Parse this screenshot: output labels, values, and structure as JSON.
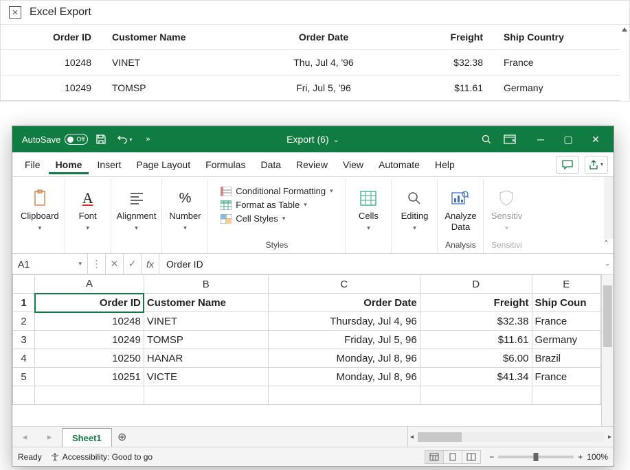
{
  "top": {
    "title": "Excel Export",
    "headers": {
      "id": "Order ID",
      "name": "Customer Name",
      "date": "Order Date",
      "freight": "Freight",
      "country": "Ship Country"
    },
    "rows": [
      {
        "id": "10248",
        "name": "VINET",
        "date": "Thu, Jul 4, '96",
        "freight": "$32.38",
        "country": "France"
      },
      {
        "id": "10249",
        "name": "TOMSP",
        "date": "Fri, Jul 5, '96",
        "freight": "$11.61",
        "country": "Germany"
      }
    ]
  },
  "excel": {
    "titlebar": {
      "autosave_label": "AutoSave",
      "autosave_state": "Off",
      "doc_title": "Export (6)"
    },
    "menu": [
      "File",
      "Home",
      "Insert",
      "Page Layout",
      "Formulas",
      "Data",
      "Review",
      "View",
      "Automate",
      "Help"
    ],
    "menu_active": "Home",
    "ribbon": {
      "clipboard": "Clipboard",
      "font": "Font",
      "alignment": "Alignment",
      "number": "Number",
      "styles": "Styles",
      "styles_items": {
        "cond": "Conditional Formatting",
        "table": "Format as Table",
        "cells": "Cell Styles"
      },
      "cells_grp": "Cells",
      "editing": "Editing",
      "analysis": "Analysis",
      "analyze": "Analyze\nData",
      "sensitivity_grp": "Sensitivi",
      "sensitivity": "Sensitiv"
    },
    "formula_bar": {
      "name_box": "A1",
      "fx_label": "fx",
      "value": "Order ID"
    },
    "sheet": {
      "cols": [
        "A",
        "B",
        "C",
        "D",
        "E"
      ],
      "header": {
        "A": "Order ID",
        "B": "Customer Name",
        "C": "Order Date",
        "D": "Freight",
        "E": "Ship Coun"
      },
      "rows": [
        {
          "n": "2",
          "A": "10248",
          "B": "VINET",
          "C": "Thursday, Jul 4, 96",
          "D": "$32.38",
          "E": "France"
        },
        {
          "n": "3",
          "A": "10249",
          "B": "TOMSP",
          "C": "Friday, Jul 5, 96",
          "D": "$11.61",
          "E": "Germany"
        },
        {
          "n": "4",
          "A": "10250",
          "B": "HANAR",
          "C": "Monday, Jul 8, 96",
          "D": "$6.00",
          "E": "Brazil"
        },
        {
          "n": "5",
          "A": "10251",
          "B": "VICTE",
          "C": "Monday, Jul 8, 96",
          "D": "$41.34",
          "E": "France"
        }
      ]
    },
    "tabs": {
      "sheet1": "Sheet1"
    },
    "status": {
      "ready": "Ready",
      "accessibility": "Accessibility: Good to go",
      "zoom": "100%"
    }
  }
}
